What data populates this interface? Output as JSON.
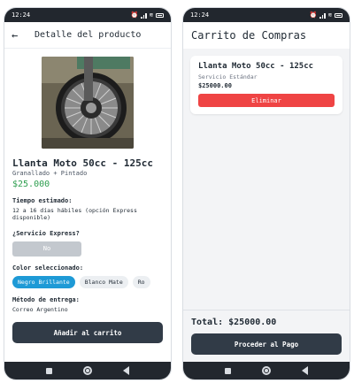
{
  "status_bar": {
    "time_left": "12:24",
    "time_right": "12:24"
  },
  "product_screen": {
    "header_title": "Detalle del producto",
    "product": {
      "title": "Llanta Moto 50cc - 125cc",
      "subtitle": "Granallado + Pintado",
      "price": "$25.000"
    },
    "estimated_time": {
      "label": "Tiempo estimado:",
      "value": "12 a 16 días hábiles (opción Express disponible)"
    },
    "express": {
      "label": "¿Servicio Express?",
      "toggle_value": "No"
    },
    "color": {
      "label": "Color seleccionado:",
      "options": [
        "Negro Brillante",
        "Blanco Mate",
        "Ro"
      ],
      "selected": "Negro Brillante"
    },
    "delivery": {
      "label": "Método de entrega:",
      "value": "Correo Argentino"
    },
    "add_to_cart_label": "Añadir al carrito"
  },
  "cart_screen": {
    "title": "Carrito de Compras",
    "item": {
      "name": "Llanta Moto 50cc - 125cc",
      "service": "Servicio Estándar",
      "price": "$25000.00",
      "remove_label": "Eliminar"
    },
    "total": "Total: $25000.00",
    "pay_label": "Proceder al Pago"
  },
  "colors": {
    "primary_dark": "#313b47",
    "price_green": "#2e9e4f",
    "chip_active": "#1e9ad6",
    "danger": "#ef4444"
  }
}
